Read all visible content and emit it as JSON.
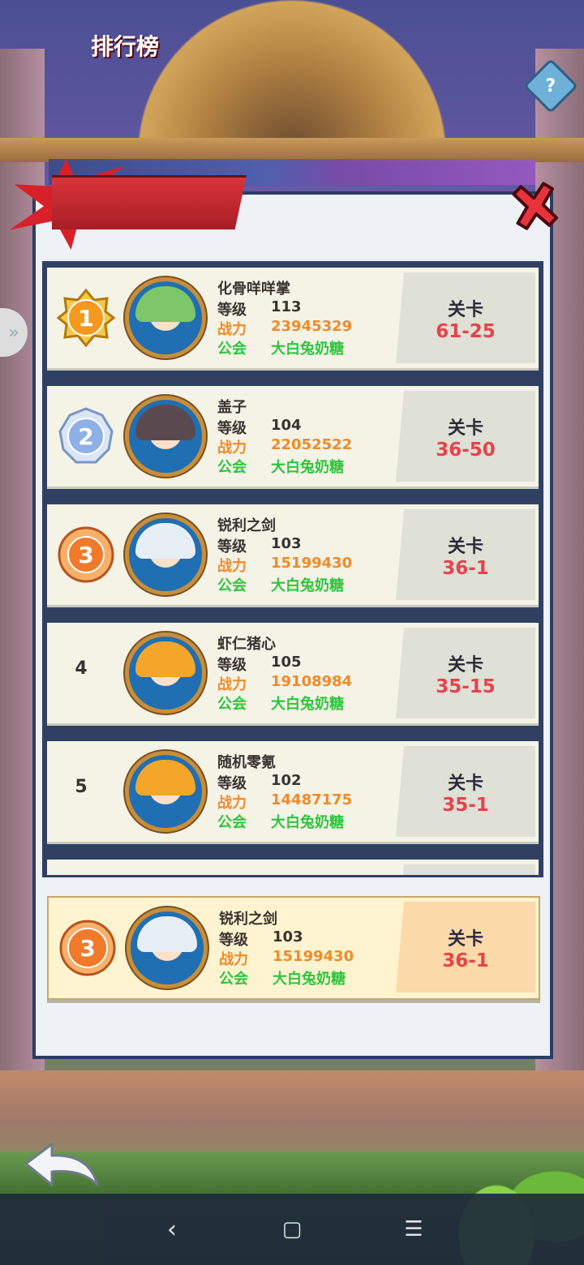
{
  "title": "排行榜",
  "help_icon": "?",
  "side_tab_icon": "»",
  "labels": {
    "level": "等级",
    "power": "战力",
    "guild": "公会",
    "stage": "关卡"
  },
  "colors": {
    "power": "#f08a2a",
    "guild": "#2fc43e",
    "stage_value": "#e8424b",
    "title_ribbon": "#d8202a"
  },
  "rankings": [
    {
      "rank": "1",
      "name": "化骨咩咩掌",
      "level": "113",
      "power": "23945329",
      "guild": "大白兔奶糖",
      "stage": "61-25",
      "medal": "gold"
    },
    {
      "rank": "2",
      "name": "盖子",
      "level": "104",
      "power": "22052522",
      "guild": "大白兔奶糖",
      "stage": "36-50",
      "medal": "silver"
    },
    {
      "rank": "3",
      "name": "锐利之剑",
      "level": "103",
      "power": "15199430",
      "guild": "大白兔奶糖",
      "stage": "36-1",
      "medal": "bronze"
    },
    {
      "rank": "4",
      "name": "虾仁猪心",
      "level": "105",
      "power": "19108984",
      "guild": "大白兔奶糖",
      "stage": "35-15",
      "medal": "none"
    },
    {
      "rank": "5",
      "name": "随机零氪",
      "level": "102",
      "power": "14487175",
      "guild": "大白兔奶糖",
      "stage": "35-1",
      "medal": "none"
    }
  ],
  "self": {
    "rank": "3",
    "name": "锐利之剑",
    "level": "103",
    "power": "15199430",
    "guild": "大白兔奶糖",
    "stage": "36-1"
  },
  "navbar": {
    "back": "‹",
    "home": "▢",
    "menu": "☰"
  }
}
